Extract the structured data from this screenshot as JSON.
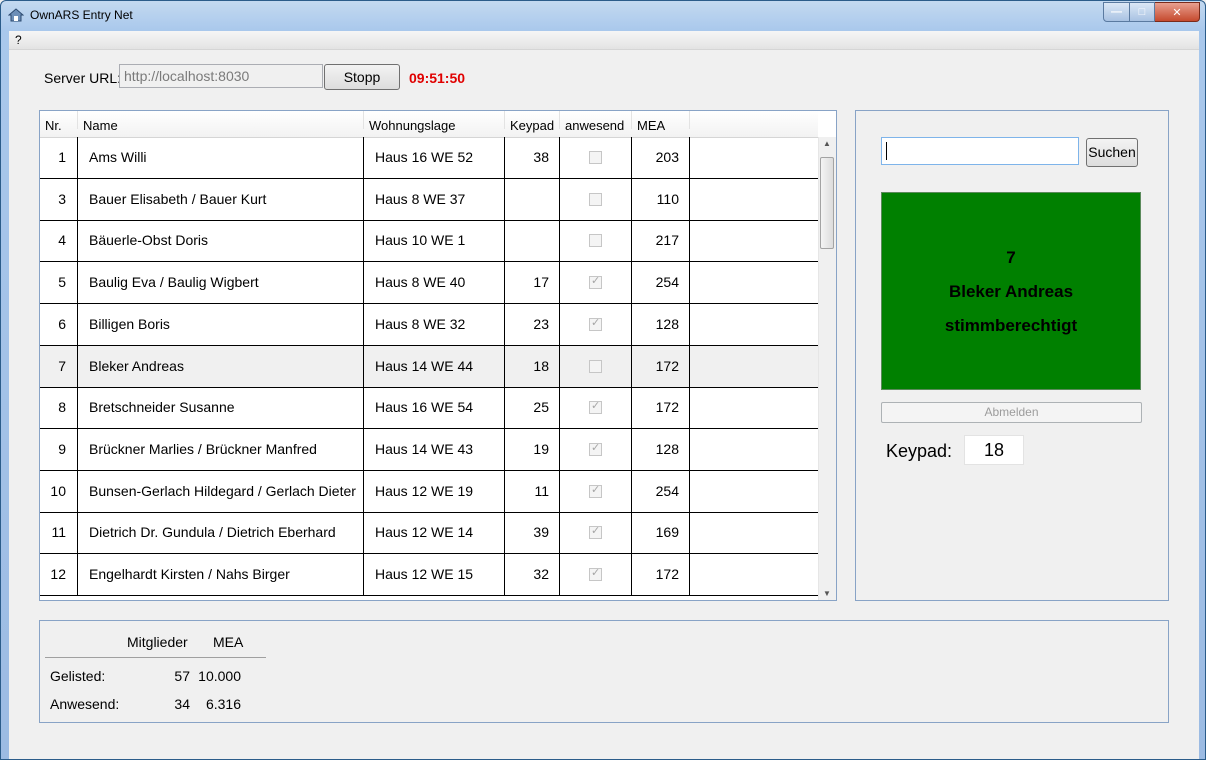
{
  "window": {
    "title": "OwnARS Entry Net"
  },
  "menu": {
    "help": "?"
  },
  "server": {
    "label": "Server URL:",
    "url": "http://localhost:8030",
    "stop_label": "Stopp",
    "clock": "09:51:50"
  },
  "table": {
    "columns": [
      "Nr.",
      "Name",
      "Wohnungslage",
      "Keypad",
      "anwesend",
      "MEA"
    ],
    "rows": [
      {
        "nr": "1",
        "name": "Ams Willi",
        "lage": "Haus 16 WE 52",
        "keypad": "38",
        "anwesend": false,
        "mea": "203"
      },
      {
        "nr": "3",
        "name": "Bauer Elisabeth / Bauer Kurt",
        "lage": "Haus 8 WE 37",
        "keypad": "",
        "anwesend": false,
        "mea": "110"
      },
      {
        "nr": "4",
        "name": "Bäuerle-Obst Doris",
        "lage": "Haus 10 WE 1",
        "keypad": "",
        "anwesend": false,
        "mea": "217"
      },
      {
        "nr": "5",
        "name": "Baulig Eva / Baulig Wigbert",
        "lage": "Haus 8 WE 40",
        "keypad": "17",
        "anwesend": true,
        "mea": "254"
      },
      {
        "nr": "6",
        "name": "Billigen Boris",
        "lage": "Haus 8 WE 32",
        "keypad": "23",
        "anwesend": true,
        "mea": "128"
      },
      {
        "nr": "7",
        "name": "Bleker Andreas",
        "lage": "Haus 14 WE 44",
        "keypad": "18",
        "anwesend": false,
        "mea": "172"
      },
      {
        "nr": "8",
        "name": "Bretschneider Susanne",
        "lage": "Haus 16 WE 54",
        "keypad": "25",
        "anwesend": true,
        "mea": "172"
      },
      {
        "nr": "9",
        "name": "Brückner Marlies / Brückner Manfred",
        "lage": "Haus 14 WE 43",
        "keypad": "19",
        "anwesend": true,
        "mea": "128"
      },
      {
        "nr": "10",
        "name": "Bunsen-Gerlach Hildegard / Gerlach Dieter",
        "lage": "Haus 12 WE 19",
        "keypad": "11",
        "anwesend": true,
        "mea": "254"
      },
      {
        "nr": "11",
        "name": "Dietrich Dr. Gundula / Dietrich Eberhard",
        "lage": "Haus 12 WE 14",
        "keypad": "39",
        "anwesend": true,
        "mea": "169"
      },
      {
        "nr": "12",
        "name": "Engelhardt Kirsten / Nahs Birger",
        "lage": "Haus 12 WE 15",
        "keypad": "32",
        "anwesend": true,
        "mea": "172"
      }
    ],
    "selected_nr": "7"
  },
  "search": {
    "value": "",
    "button_label": "Suchen"
  },
  "status": {
    "line1": "7",
    "line2": "Bleker Andreas",
    "line3": "stimmberechtigt",
    "color": "#008000"
  },
  "abmelden_label": "Abmelden",
  "keypad": {
    "label": "Keypad:",
    "value": "18"
  },
  "summary": {
    "col_members": "Mitglieder",
    "col_mea": "MEA",
    "listed_label": "Gelisted:",
    "listed_members": "57",
    "listed_mea": "10.000",
    "present_label": "Anwesend:",
    "present_members": "34",
    "present_mea": "6.316"
  }
}
